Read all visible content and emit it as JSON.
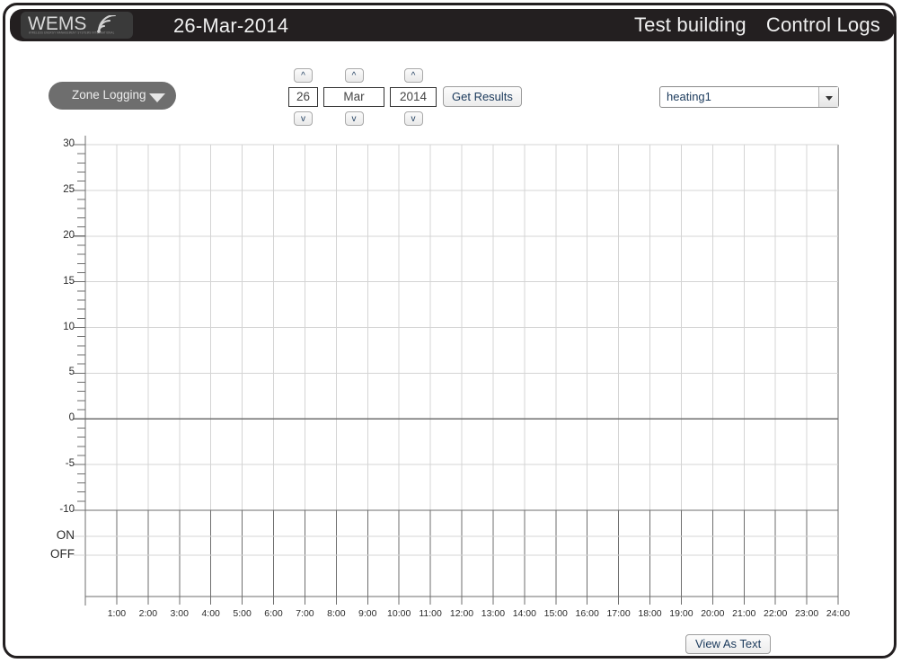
{
  "header": {
    "logo_wordmark": "WEMS",
    "logo_tagline": "WIRELESS ENERGY MANAGEMENT SYSTEMS INTERNATIONAL",
    "logo_icon": "wifi-signal-icon",
    "date_title": "26-Mar-2014",
    "building_name": "Test building",
    "page_name": "Control Logs",
    "background_color": "#231f20",
    "text_color": "#f0f0f0"
  },
  "toolbar": {
    "mode_dropdown_label": "Zone Logging",
    "mode_dropdown_icon": "chevron-down-icon",
    "day": {
      "value": "26",
      "up_label": "^",
      "down_label": "v"
    },
    "month": {
      "value": "Mar",
      "up_label": "^",
      "down_label": "v"
    },
    "year": {
      "value": "2014",
      "up_label": "^",
      "down_label": "v"
    },
    "get_results_label": "Get Results",
    "channel_select": {
      "value": "heating1",
      "icon": "chevron-down-icon"
    }
  },
  "footer": {
    "view_as_text_label": "View As Text"
  },
  "chart_data": {
    "type": "line",
    "title": "",
    "xlabel": "",
    "ylabel": "",
    "series": [
      {
        "name": "heating1",
        "x": [],
        "values": []
      }
    ],
    "x": [],
    "x_tick_labels": [
      "1:00",
      "2:00",
      "3:00",
      "4:00",
      "5:00",
      "6:00",
      "7:00",
      "8:00",
      "9:00",
      "10:00",
      "11:00",
      "12:00",
      "13:00",
      "14:00",
      "15:00",
      "16:00",
      "17:00",
      "18:00",
      "19:00",
      "20:00",
      "21:00",
      "22:00",
      "23:00",
      "24:00"
    ],
    "x_tick_values": [
      1,
      2,
      3,
      4,
      5,
      6,
      7,
      8,
      9,
      10,
      11,
      12,
      13,
      14,
      15,
      16,
      17,
      18,
      19,
      20,
      21,
      22,
      23,
      24
    ],
    "xlim": [
      0,
      24
    ],
    "y_tick_labels": [
      "30",
      "25",
      "20",
      "15",
      "10",
      "5",
      "0",
      "-5",
      "-10"
    ],
    "y_tick_values": [
      30,
      25,
      20,
      15,
      10,
      5,
      0,
      -5,
      -10
    ],
    "ylim": [
      -10,
      30
    ],
    "y_minor_tick_step": 1,
    "state_axis_labels": [
      "ON",
      "OFF"
    ],
    "grid": true,
    "grid_color": "#d4d4d4",
    "axis_color": "#6e6e6e",
    "legend": "none",
    "data_points": 0,
    "note": "empty plot - no data series rendered"
  }
}
